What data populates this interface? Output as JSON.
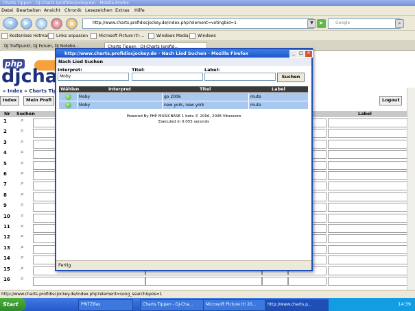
{
  "browser": {
    "title": "Charts Tippen - DJ-Charts (profidiscjockey.de) - Mozilla Firefox",
    "menu": [
      "Datei",
      "Bearbeiten",
      "Ansicht",
      "Chronik",
      "Lesezeichen",
      "Extras",
      "Hilfe"
    ],
    "url": "http://www.charts.profidiscjockey.de/index.php?element=votingbid=1",
    "search_placeholder": "Google",
    "bookmarks": [
      "Kostenlose Hotmail",
      "Links anpassen",
      "Microsoft Picture It!-...",
      "Windows Media",
      "Windows"
    ],
    "tabs": [
      "DJ Treffpunkt, DJ Forum, DJ Notebo...",
      "Charts Tippen - DJ-Charts (profid..."
    ],
    "status": "http://www.charts.profidiscjockey.de/index.php?element=song_search&pos=1"
  },
  "page": {
    "logo_top": "php",
    "logo_main": "djchar",
    "breadcrumb": "» Index » Charts Tippen",
    "btn_index": "Index",
    "btn_mein": "Mein Profi",
    "btn_logout": "Logout",
    "col_nr": "Nr",
    "col_suchen": "Suchen",
    "col_label": "Label",
    "rows": [
      "1",
      "2",
      "3",
      "4",
      "5",
      "6",
      "7",
      "8",
      "9",
      "10",
      "11",
      "12",
      "13",
      "14",
      "15",
      "16"
    ]
  },
  "popup": {
    "title": "http://www.charts.profidiscjockey.de - Nach Lied Suchen - Mozilla Firefox",
    "header": "Nach Lied Suchen",
    "label_interpret": "Interpret:",
    "label_titel": "Titel:",
    "label_label": "Label:",
    "value_interpret": "Moby",
    "value_titel": "",
    "value_label": "",
    "submit": "Suchen",
    "columns": [
      "Wählen",
      "Interpret",
      "Titel",
      "Label"
    ],
    "results": [
      {
        "interpret": "Moby",
        "titel": "go 2006",
        "label": "mute"
      },
      {
        "interpret": "Moby",
        "titel": "new york, new york",
        "label": "mute"
      }
    ],
    "powered": "Powered By PHP MUSICBASE 1 beta © 2006, 2008 Vibescore",
    "executed": "Executed in 0.055 seconds",
    "status": "Fertig"
  },
  "taskbar": {
    "start": "Start",
    "items": [
      "PRITZIfax",
      "Charts Tippen - DJ-Cha...",
      "Microsoft Picture It! 20...",
      "http://www.charts.p..."
    ],
    "clock": "14:39"
  }
}
